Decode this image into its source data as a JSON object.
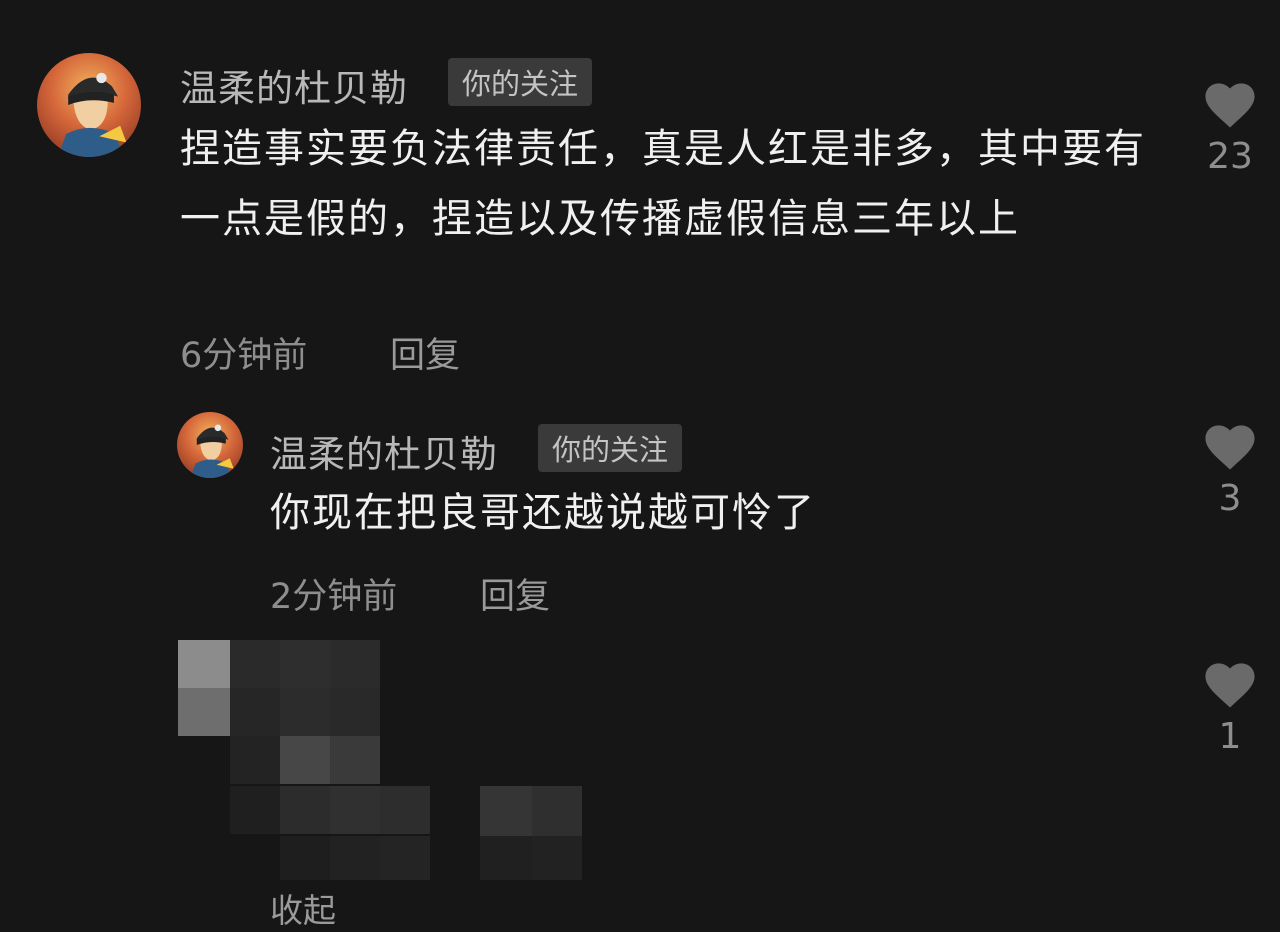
{
  "comments": [
    {
      "username": "温柔的杜贝勒",
      "badge": "你的关注",
      "text": "捏造事实要负法律责任，真是人红是非多，其中要有一点是假的，捏造以及传播虚假信息三年以上",
      "time": "6分钟前",
      "reply_label": "回复",
      "likes": "23"
    },
    {
      "username": "温柔的杜贝勒",
      "badge": "你的关注",
      "text": "你现在把良哥还越说越可怜了",
      "time": "2分钟前",
      "reply_label": "回复",
      "likes": "3"
    },
    {
      "likes": "1"
    }
  ],
  "footer": {
    "collapse_label": "收起"
  },
  "colors": {
    "background": "#161616",
    "like_icon": "#6a6a6a",
    "badge_bg": "#3a3a3a"
  },
  "icons": {
    "like": "heart-icon",
    "avatar": "cartoon-avatar"
  }
}
